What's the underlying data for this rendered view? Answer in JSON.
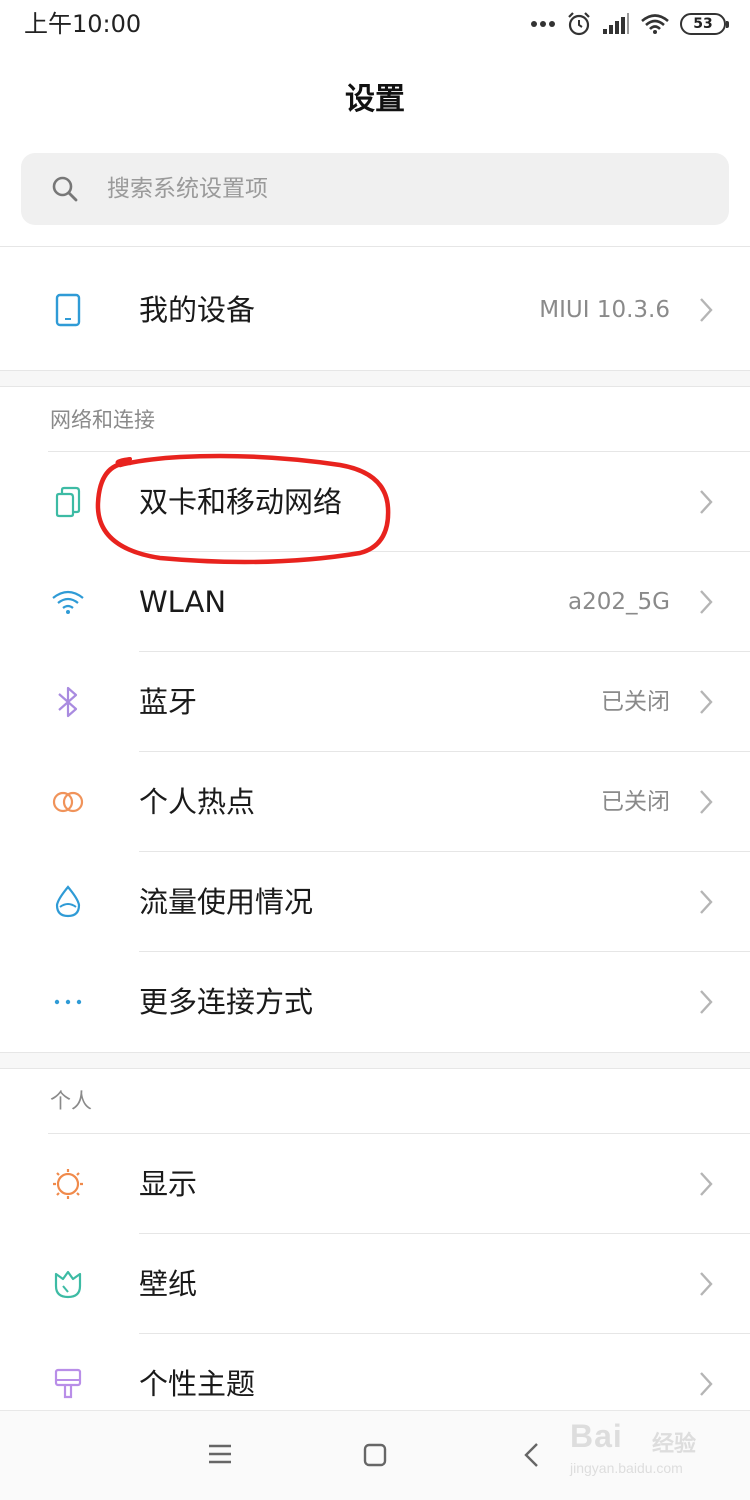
{
  "status_bar": {
    "time": "上午10:00",
    "battery_level": "53",
    "icons": [
      "more-dots-icon",
      "alarm-icon",
      "signal-icon",
      "wifi-icon",
      "battery-icon"
    ]
  },
  "header": {
    "title": "设置"
  },
  "search": {
    "placeholder": "搜索系统设置项"
  },
  "device_row": {
    "label": "我的设备",
    "value": "MIUI 10.3.6",
    "icon": "phone-icon"
  },
  "network_section": {
    "header": "网络和连接",
    "items": [
      {
        "label": "双卡和移动网络",
        "value": "",
        "icon": "sim-card-icon"
      },
      {
        "label": "WLAN",
        "value": "a202_5G",
        "icon": "wifi-icon"
      },
      {
        "label": "蓝牙",
        "value": "已关闭",
        "icon": "bluetooth-icon"
      },
      {
        "label": "个人热点",
        "value": "已关闭",
        "icon": "hotspot-icon"
      },
      {
        "label": "流量使用情况",
        "value": "",
        "icon": "data-usage-icon"
      },
      {
        "label": "更多连接方式",
        "value": "",
        "icon": "more-connections-icon"
      }
    ]
  },
  "personal_section": {
    "header": "个人",
    "items": [
      {
        "label": "显示",
        "value": "",
        "icon": "display-sun-icon"
      },
      {
        "label": "壁纸",
        "value": "",
        "icon": "wallpaper-icon"
      },
      {
        "label": "个性主题",
        "value": "",
        "icon": "theme-brush-icon"
      }
    ]
  },
  "nav_bar": {
    "buttons": [
      "menu-icon",
      "home-icon",
      "back-icon"
    ]
  },
  "watermark": {
    "brand": "Bai",
    "brand_cn": "经验",
    "sub": "jingyan.baidu.com"
  },
  "colors": {
    "accent_blue": "#2f9bd6",
    "bluetooth_purple": "#a98be0",
    "hotspot_orange": "#f0935a",
    "wallpaper_teal": "#3dbba4",
    "theme_purple": "#b98ee8",
    "display_orange": "#f08a4b",
    "highlight_red": "#e8231e"
  }
}
